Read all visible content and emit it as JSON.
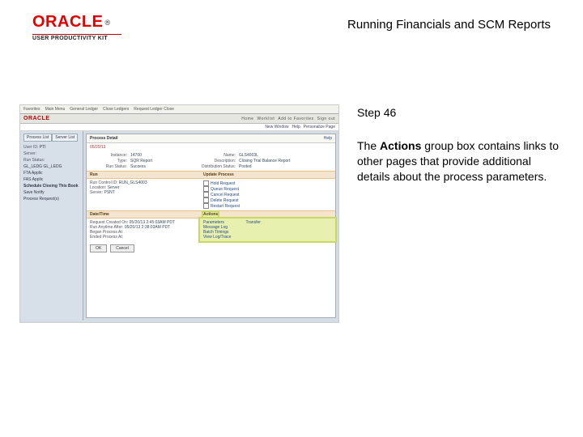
{
  "brand": {
    "name": "ORACLE",
    "registered": "®",
    "subtitle": "USER PRODUCTIVITY KIT"
  },
  "doc": {
    "title": "Running Financials and SCM Reports",
    "step_label": "Step 46",
    "step_text_pre": "The ",
    "step_text_bold": "Actions",
    "step_text_post": " group box contains links to other pages that provide additional details about the process parameters."
  },
  "ss": {
    "topnav": [
      "Favorites",
      "Main Menu",
      "General Ledger",
      "Close Ledgers",
      "Request Ledger Close"
    ],
    "brand": "ORACLE",
    "brand_right": [
      "Home",
      "Worklist",
      "Add to Favorites",
      "Sign out"
    ],
    "subline": [
      "New Window",
      "Help",
      "Personalize Page"
    ],
    "side": {
      "tabs": [
        "Process List",
        "Server List"
      ],
      "lbl_userid": "User ID:",
      "val_userid": "PTI",
      "lbl_server": "Server:",
      "val_server": "",
      "lbl_runstatus": "Run Status:",
      "val_runstatus": "",
      "g1": [
        "GL_LEDG",
        "GL_LEDG"
      ],
      "g2": [
        "FTA",
        "Applic"
      ],
      "g3": [
        "FAS",
        "Applic"
      ],
      "sched": "Schedule Closing This Book",
      "schedrow": [
        "Save",
        "Notify"
      ],
      "footer": "Process Request(s)"
    },
    "panel": {
      "title": "Process Detail",
      "help": "Help",
      "date": "05/20/13",
      "k_instance": "Instance:",
      "v_instance": "14700",
      "k_type": "Type:",
      "v_type": "SQR Report",
      "k_name": "Name:",
      "v_name": "GLS4003L",
      "k_desc": "Description:",
      "v_desc": "Closing Trial Balance Report",
      "k_runstat": "Run Status:",
      "v_runstat": "Success",
      "k_dist": "Distribution Status:",
      "v_dist": "Posted",
      "bar_run": "Run",
      "bar_update": "Update Process",
      "k_runcntl": "Run Control ID:",
      "v_runcntl": "RUN_GLS4003",
      "k_loc": "Location:",
      "v_loc": "Server",
      "k_srv": "Server:",
      "v_srv": "PSNT",
      "updates": [
        "Hold Request",
        "Queue Request",
        "Cancel Request",
        "Delete Request",
        "Restart Request"
      ],
      "bar_dt": "Date/Time",
      "bar_actions": "Actions",
      "k_req": "Request Created On:",
      "v_req": "05/20/13 2:45:03AM PDT",
      "k_run": "Run Anytime After:",
      "v_run": "05/20/13 2:38:03AM PDT",
      "k_beg": "Began Process At:",
      "k_end": "Ended Process At:",
      "actions": [
        "Parameters",
        "Message Log",
        "Batch Timings",
        "View Log/Trace"
      ],
      "actions_r": [
        "Transfer"
      ],
      "btn_ok": "OK",
      "btn_cancel": "Cancel"
    }
  }
}
